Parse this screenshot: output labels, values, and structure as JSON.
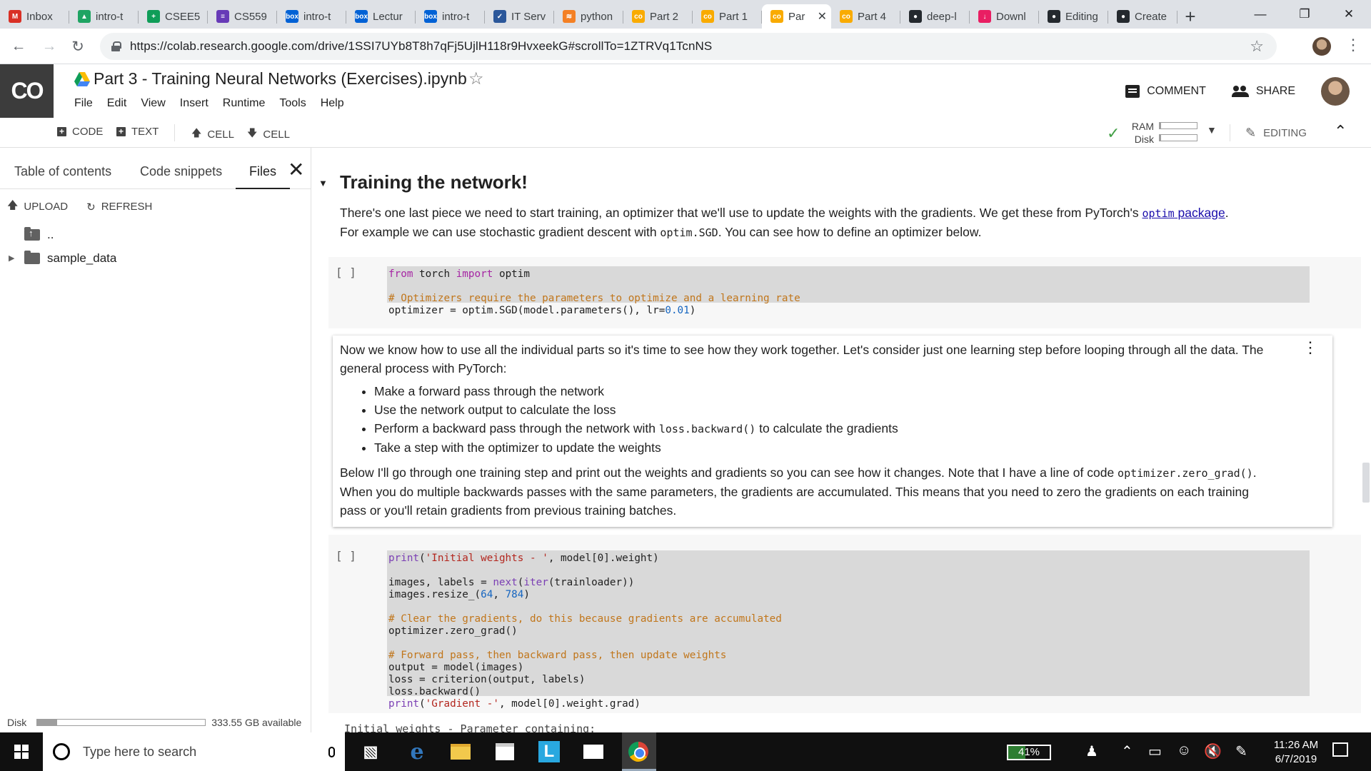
{
  "browser": {
    "tabs": [
      {
        "title": "Inbox",
        "icon": "gmail-icon",
        "color": "#d93025",
        "glyph": "M"
      },
      {
        "title": "intro-t",
        "icon": "google-drive-icon",
        "color": "#1fa463",
        "glyph": "▲"
      },
      {
        "title": "CSEE5",
        "icon": "google-sheets-icon",
        "color": "#0f9d58",
        "glyph": "+"
      },
      {
        "title": "CS559",
        "icon": "google-forms-icon",
        "color": "#673ab7",
        "glyph": "≡"
      },
      {
        "title": "intro-t",
        "icon": "box-icon",
        "color": "#0061d5",
        "glyph": "box"
      },
      {
        "title": "Lectur",
        "icon": "box-icon",
        "color": "#0061d5",
        "glyph": "box"
      },
      {
        "title": "intro-t",
        "icon": "box-icon",
        "color": "#0061d5",
        "glyph": "box"
      },
      {
        "title": "IT Serv",
        "icon": "servicenow-icon",
        "color": "#2b579a",
        "glyph": "✓"
      },
      {
        "title": "python",
        "icon": "stackoverflow-icon",
        "color": "#f48024",
        "glyph": "≋"
      },
      {
        "title": "Part 2",
        "icon": "colab-icon",
        "color": "#f9ab00",
        "glyph": "co"
      },
      {
        "title": "Part 1",
        "icon": "colab-icon",
        "color": "#f9ab00",
        "glyph": "co"
      },
      {
        "title": "Par",
        "icon": "colab-icon",
        "color": "#f9ab00",
        "glyph": "co",
        "active": true
      },
      {
        "title": "Part 4",
        "icon": "colab-icon",
        "color": "#f9ab00",
        "glyph": "co"
      },
      {
        "title": "deep-l",
        "icon": "github-icon",
        "color": "#24292e",
        "glyph": "●"
      },
      {
        "title": "Downl",
        "icon": "download-icon",
        "color": "#e91e63",
        "glyph": "↓"
      },
      {
        "title": "Editing",
        "icon": "github-icon",
        "color": "#24292e",
        "glyph": "●"
      },
      {
        "title": "Create",
        "icon": "github-icon",
        "color": "#24292e",
        "glyph": "●"
      }
    ],
    "url": "https://colab.research.google.com/drive/1SSI7UYb8T8h7qFj5UjlH118r9HvxeekG#scrollTo=1ZTRVq1TcnNS"
  },
  "colab": {
    "logo": "CO",
    "notebook_title": "Part 3 - Training Neural Networks (Exercises).ipynb",
    "menu": [
      "File",
      "Edit",
      "View",
      "Insert",
      "Runtime",
      "Tools",
      "Help"
    ],
    "comment_label": "COMMENT",
    "share_label": "SHARE",
    "toolbar": {
      "code_label": "CODE",
      "text_label": "TEXT",
      "cell_up_label": "CELL",
      "cell_down_label": "CELL",
      "ram_label": "RAM",
      "disk_label": "Disk",
      "ram_usage": 0.03,
      "disk_usage": 0.03,
      "editing_label": "EDITING"
    }
  },
  "side_panel": {
    "tabs": [
      "Table of contents",
      "Code snippets",
      "Files"
    ],
    "active_tab": "Files",
    "upload_label": "UPLOAD",
    "refresh_label": "REFRESH",
    "files": [
      {
        "name": "..",
        "type": "parent"
      },
      {
        "name": "sample_data",
        "type": "folder"
      }
    ],
    "disk_label": "Disk",
    "disk_usage": 0.12,
    "disk_available": "333.55 GB available"
  },
  "notebook": {
    "section_heading": "Training the network!",
    "intro": {
      "p1_a": "There's one last piece we need to start training, an optimizer that we'll use to update the weights with the gradients. We get these from PyTorch's ",
      "p1_link_code": "optim",
      "p1_link_text": " package",
      "p1_b": ".",
      "p2_a": "For example we can use stochastic gradient descent with ",
      "p2_code": "optim.SGD",
      "p2_b": ". You can see how to define an optimizer below."
    },
    "code_cell_1": {
      "run_label": "[ ]",
      "line1_kw": "from",
      "line1_mod": " torch ",
      "line1_kw2": "import",
      "line1_name": " optim",
      "comment": "# Optimizers require the parameters to optimize and a learning rate",
      "line3_a": "optimizer = optim.SGD(model.parameters(), lr=",
      "line3_num": "0.01",
      "line3_b": ")"
    },
    "md_cell": {
      "p1": "Now we know how to use all the individual parts so it's time to see how they work together. Let's consider just one learning step before looping through all the data. The general process with PyTorch:",
      "bullets": [
        {
          "text": "Make a forward pass through the network"
        },
        {
          "text": "Use the network output to calculate the loss"
        },
        {
          "text_a": "Perform a backward pass through the network with ",
          "code": "loss.backward()",
          "text_b": " to calculate the gradients"
        },
        {
          "text": "Take a step with the optimizer to update the weights"
        }
      ],
      "p2_a": "Below I'll go through one training step and print out the weights and gradients so you can see how it changes. Note that I have a line of code ",
      "p2_code": "optimizer.zero_grad()",
      "p2_b": ". When you do multiple backwards passes with the same parameters, the gradients are accumulated. This means that you need to zero the gradients on each training pass or you'll retain gradients from previous training batches."
    },
    "code_cell_2": {
      "run_label": "[ ]",
      "l1_fn": "print",
      "l1_str": "'Initial weights - '",
      "l1_rest": ", model[0].weight)",
      "l2_a": "images, labels = ",
      "l2_next": "next",
      "l2_iter": "iter",
      "l2_b": "(trainloader))",
      "l3_a": "images.resize_(",
      "l3_n1": "64",
      "l3_n2": "784",
      "comment1": "# Clear the gradients, do this because gradients are accumulated",
      "l5": "optimizer.zero_grad()",
      "comment2": "# Forward pass, then backward pass, then update weights",
      "l7": "output = model(images)",
      "l8": "loss = criterion(output, labels)",
      "l9": "loss.backward()",
      "l10_fn": "print",
      "l10_str": "'Gradient -'",
      "l10_rest": ", model[0].weight.grad)"
    },
    "output_peek": "Initial weights -  Parameter containing:"
  },
  "taskbar": {
    "search_placeholder": "Type here to search",
    "battery": "41%",
    "battery_level": 0.41,
    "time": "11:26 AM",
    "date": "6/7/2019"
  }
}
